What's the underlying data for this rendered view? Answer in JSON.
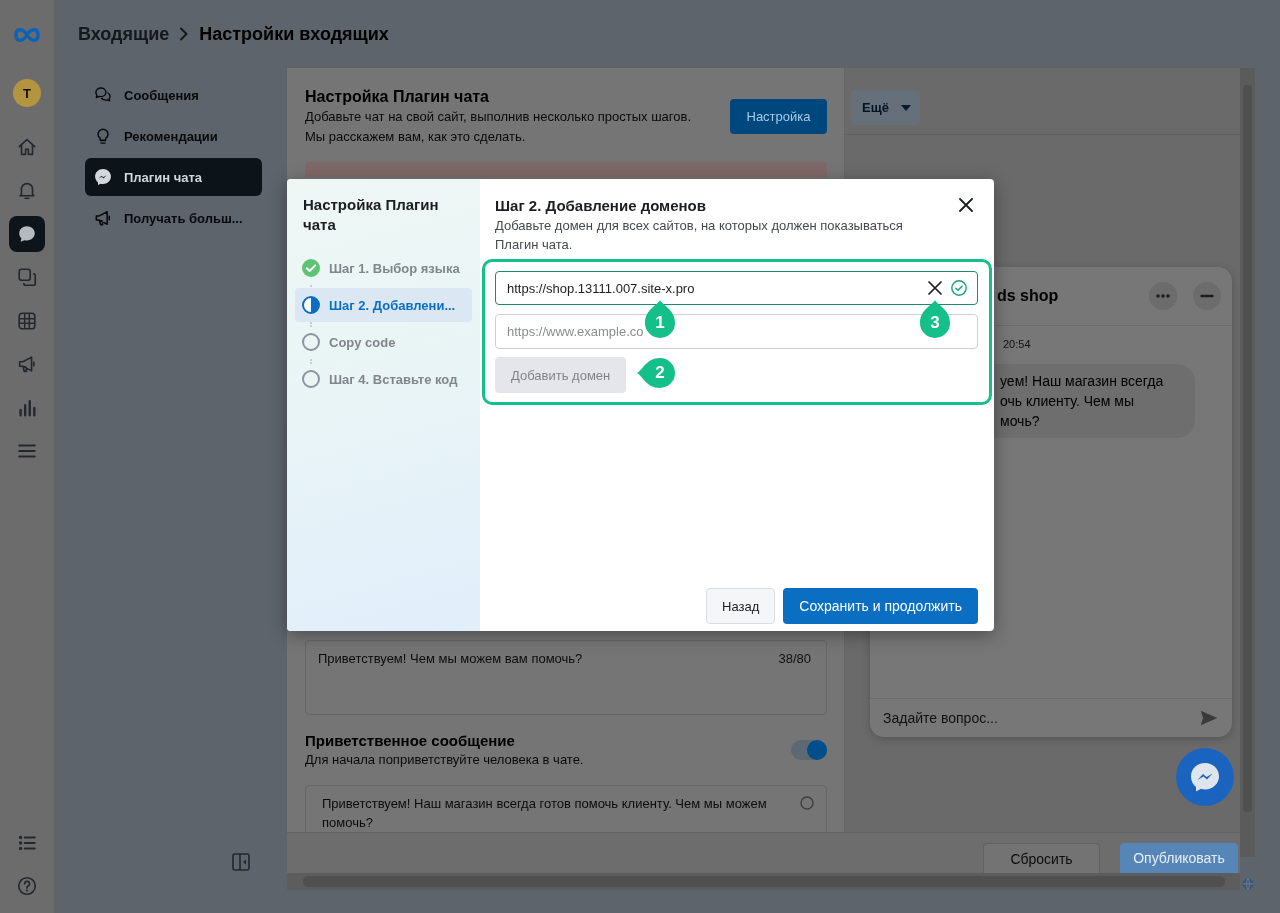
{
  "rail": {
    "avatar": "T",
    "items": [
      {
        "kind": "home",
        "selected": false
      },
      {
        "kind": "bell",
        "selected": false
      },
      {
        "kind": "chat",
        "selected": true
      },
      {
        "kind": "pages",
        "selected": false
      },
      {
        "kind": "grid",
        "selected": false
      },
      {
        "kind": "megaphone",
        "selected": false
      },
      {
        "kind": "bars",
        "selected": false
      },
      {
        "kind": "menu",
        "selected": false
      }
    ],
    "bottom_items": [
      {
        "kind": "list",
        "selected": false
      },
      {
        "kind": "help",
        "selected": false
      }
    ]
  },
  "breadcrumb": [
    {
      "label": "Входящие",
      "current": false
    },
    {
      "label": "Настройки входящих",
      "current": true
    }
  ],
  "subnav": {
    "items": [
      {
        "kind": "chats",
        "label": "Сообщения",
        "selected": false
      },
      {
        "kind": "bulb",
        "label": "Рекомендации",
        "selected": false
      },
      {
        "kind": "messenger",
        "label": "Плагин чата",
        "selected": true
      },
      {
        "kind": "megaphone",
        "label": "Получать больш...",
        "selected": false
      }
    ]
  },
  "settings": {
    "title": "Настройка Плагин чата",
    "description": "Добавьте чат на свой сайт, выполнив несколько простых шагов. Мы расскажем вам, как это сделать.",
    "button": "Настройка",
    "icebreaker": {
      "value": "Приветствуем! Чем мы можем вам помочь?",
      "counter": "38/80"
    },
    "greeting": {
      "title": "Приветственное сообщение",
      "description": "Для начала поприветствуйте человека в чате.",
      "on": true,
      "message": "Приветствуем! Наш магазин всегда готов помочь клиенту. Чем мы можем помочь?"
    }
  },
  "preview": {
    "menu": "Ещё",
    "chat": {
      "name": "ds shop",
      "time": "20:54",
      "message_lines": [
        "уем! Наш магазин всегда",
        "очь клиенту. Чем мы",
        "мочь?"
      ],
      "input_placeholder": "Задайте вопрос..."
    }
  },
  "footer": {
    "buttons": [
      {
        "label": "Сбросить",
        "kind": "secondary"
      },
      {
        "label": "Опубликовать",
        "kind": "primary"
      }
    ]
  },
  "dialog": {
    "sidebar_title": "Настройка Плагин чата",
    "steps": [
      {
        "label": "Шаг 1. Выбор языка",
        "kind": "done",
        "selected": false
      },
      {
        "label": "Шаг 2. Добавлени...",
        "kind": "current",
        "selected": true
      },
      {
        "label": "Copy code",
        "kind": "todo",
        "selected": false
      },
      {
        "label": "Шаг 4. Вставьте код",
        "kind": "todo",
        "selected": false
      }
    ],
    "title": "Шаг 2. Добавление доменов",
    "description": "Добавьте домен для всех сайтов, на которых должен показываться Плагин чата.",
    "domains": [
      {
        "value": "https://shop.13111.007.site-x.pro",
        "valid": true
      },
      {
        "placeholder": "https://www.example.co"
      }
    ],
    "add_button": {
      "label": "Добавить домен",
      "disabled": true
    },
    "callouts": [
      {
        "label": "1",
        "kind": "up"
      },
      {
        "label": "2",
        "kind": "left"
      },
      {
        "label": "3",
        "kind": "up"
      }
    ],
    "buttons": [
      {
        "label": "Назад",
        "kind": "secondary"
      },
      {
        "label": "Сохранить и продолжить",
        "kind": "primary"
      }
    ]
  }
}
